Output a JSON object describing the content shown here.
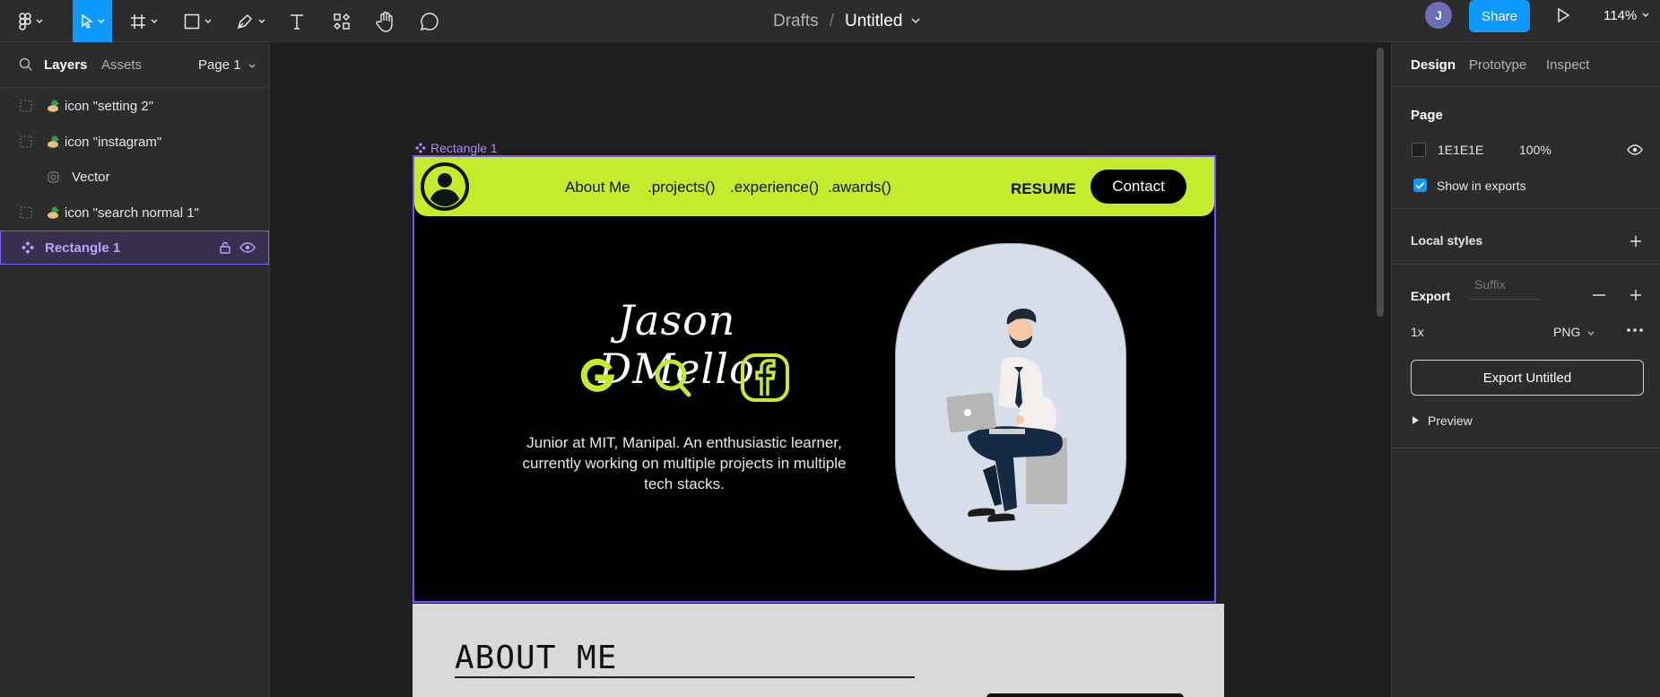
{
  "topbar": {
    "breadcrumb": {
      "drafts": "Drafts",
      "separator": "/",
      "file_title": "Untitled"
    },
    "avatar_initial": "J",
    "share_label": "Share",
    "zoom": "114%",
    "tools": [
      "figma-menu-icon",
      "move-icon",
      "frame-icon",
      "rectangle-icon",
      "pen-icon",
      "text-icon",
      "components-icon",
      "hand-icon",
      "comment-icon"
    ]
  },
  "left_panel": {
    "tabs": {
      "layers": "Layers",
      "assets": "Assets",
      "page": "Page 1"
    },
    "layers": [
      {
        "label": "icon \"setting 2\""
      },
      {
        "label": "icon \"instagram\""
      },
      {
        "label": "Vector"
      },
      {
        "label": "icon \"search normal 1\""
      },
      {
        "label": "Rectangle 1"
      }
    ]
  },
  "canvas": {
    "frame_label": "Rectangle 1",
    "nav": {
      "items": [
        "About Me",
        ".projects()",
        ".experience()",
        ".awards()"
      ],
      "resume": "RESUME",
      "contact": "Contact"
    },
    "hero": {
      "name": "Jason DMello",
      "bio": "Junior at MIT, Manipal. An enthusiastic learner, currently working on multiple projects in multiple tech stacks."
    },
    "about": {
      "title": "ABOUT ME"
    },
    "colors": {
      "accent": "#c5eb2d",
      "selection": "#7b4dff"
    }
  },
  "right_panel": {
    "tabs": {
      "design": "Design",
      "prototype": "Prototype",
      "inspect": "Inspect"
    },
    "page_heading": "Page",
    "page_color": "1E1E1E",
    "page_opacity": "100%",
    "show_in_exports": "Show in exports",
    "local_styles": "Local styles",
    "export_heading": "Export",
    "export_scale": "1x",
    "suffix_placeholder": "Suffix",
    "export_format": "PNG",
    "export_button": "Export Untitled",
    "preview": "Preview"
  }
}
